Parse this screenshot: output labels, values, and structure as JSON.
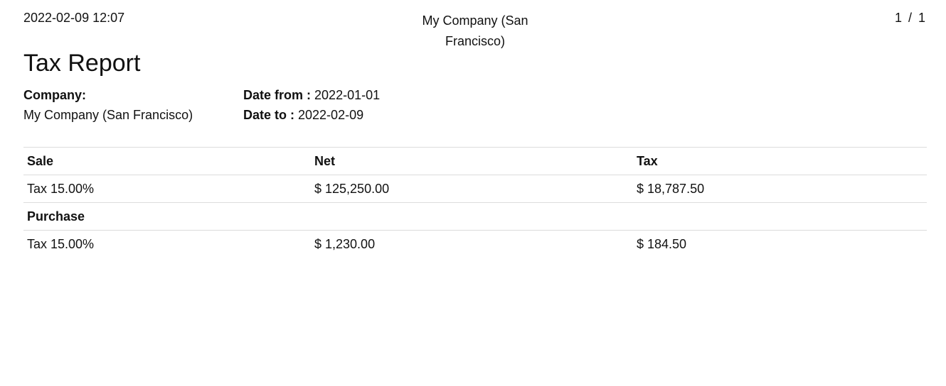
{
  "header": {
    "datetime": "2022-02-09 12:07",
    "company_line1": "My Company (San",
    "company_line2": "Francisco)",
    "page_current": "1",
    "page_separator": "/",
    "page_total": "1"
  },
  "report": {
    "title": "Tax Report",
    "company_label": "Company:",
    "company_value": "My Company (San Francisco)",
    "date_from_label": "Date from :",
    "date_from_value": "2022-01-01",
    "date_to_label": "Date to :",
    "date_to_value": "2022-02-09"
  },
  "table": {
    "sale_section": "Sale",
    "col_net": "Net",
    "col_tax": "Tax",
    "sale_rows": [
      {
        "name": "Tax 15.00%",
        "net": "$ 125,250.00",
        "tax": "$ 18,787.50"
      }
    ],
    "purchase_section": "Purchase",
    "purchase_rows": [
      {
        "name": "Tax 15.00%",
        "net": "$ 1,230.00",
        "tax": "$ 184.50"
      }
    ]
  }
}
